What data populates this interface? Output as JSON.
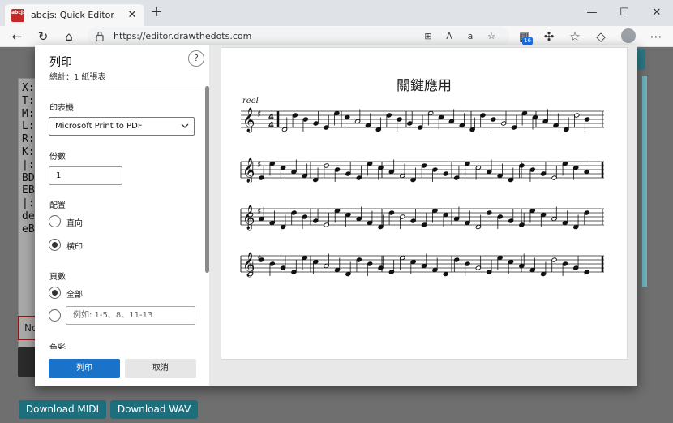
{
  "browser": {
    "tab_title": "abcjs: Quick Editor",
    "favicon_text": "abcjs",
    "url": "https://editor.drawthedots.com",
    "extension_badge": "16"
  },
  "page": {
    "editor_lines": [
      "X:",
      "T:",
      "M:",
      "L:",
      "R:",
      "K:",
      "|:",
      "BD",
      "EB",
      "|:",
      "de",
      "eB"
    ],
    "warn_text": "No",
    "download_midi": "Download MIDI",
    "download_wav": "Download WAV"
  },
  "print_dialog": {
    "title": "列印",
    "subtitle": "總計：1 紙張表",
    "printer_label": "印表機",
    "printer_value": "Microsoft Print to PDF",
    "copies_label": "份數",
    "copies_value": "1",
    "layout_label": "配置",
    "layout_options": [
      {
        "label": "直向",
        "selected": false
      },
      {
        "label": "橫印",
        "selected": true
      }
    ],
    "pages_label": "頁數",
    "pages_options": [
      {
        "label": "全部",
        "selected": true
      }
    ],
    "pages_placeholder": "例如: 1-5、8、11-13",
    "color_label": "色彩",
    "print_button": "列印",
    "cancel_button": "取消",
    "help_icon": "?"
  },
  "preview": {
    "score_title": "關鍵應用",
    "tempo_text": "reel",
    "staff_count": 4
  }
}
